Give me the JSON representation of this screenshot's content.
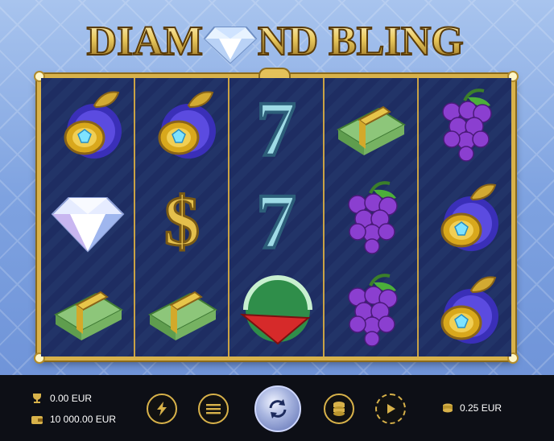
{
  "game": {
    "title_left": "DIAM",
    "title_right": "ND BLING",
    "accent": "#d8b24a"
  },
  "reels": [
    [
      "plum-icon",
      "diamond-icon",
      "cash-stack-icon"
    ],
    [
      "plum-icon",
      "dollar-sign-icon",
      "cash-stack-icon"
    ],
    [
      "seven-icon",
      "seven-icon",
      "watermelon-icon"
    ],
    [
      "cash-stack-icon",
      "grapes-icon",
      "grapes-icon"
    ],
    [
      "grapes-icon",
      "plum-icon",
      "plum-icon"
    ]
  ],
  "hud": {
    "win": "0.00 EUR",
    "balance": "10 000.00 EUR",
    "bet": "0.25 EUR"
  },
  "buttons": [
    "turbo-icon",
    "menu-icon",
    "spin-icon",
    "coins-icon",
    "autoplay-icon"
  ]
}
